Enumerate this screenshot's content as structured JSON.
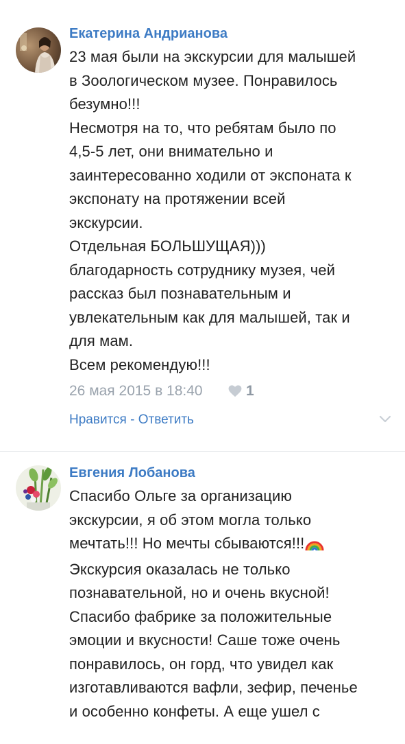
{
  "comments": [
    {
      "author": "Екатерина Андрианова",
      "lines": [
        "23 мая были на экскурсии для малышей",
        "в Зоологическом музее. Понравилось",
        "безумно!!!",
        "Несмотря на то, что ребятам было по",
        "4,5-5 лет, они внимательно и",
        "заинтересованно ходили от экспоната к",
        "экспонату на протяжении всей",
        "экскурсии.",
        "Отдельная БОЛЬШУЩАЯ)))",
        "благодарность сотруднику музея, чей",
        "рассказ был познавательным и",
        "увлекательным как для малышей, так и",
        "для мам.",
        "Всем рекомендую!!!"
      ],
      "date": "26 мая 2015 в 18:40",
      "like_count": "1",
      "like_label": "Нравится",
      "separator": " - ",
      "reply_label": "Ответить"
    },
    {
      "author": "Евгения Лобанова",
      "lines": [
        "Спасибо Ольге за организацию",
        "экскурсии, я об этом могла только",
        "мечтать!!! Но мечты сбываются!!!",
        "Экскурсия оказалась не только",
        "познавательной, но и очень вкусной!",
        "Спасибо фабрике за положительные",
        "эмоции и вкусности! Саше тоже очень",
        "понравилось, он горд, что увидел как",
        "изготавливаются вафли, зефир, печенье",
        "и особенно конфеты. А еще ушел с"
      ],
      "emoji": "rainbow-emoji"
    }
  ],
  "colors": {
    "link": "#3d7bc4",
    "meta": "#9aa3ad",
    "text": "#222222",
    "divider": "#e2e5e8"
  }
}
